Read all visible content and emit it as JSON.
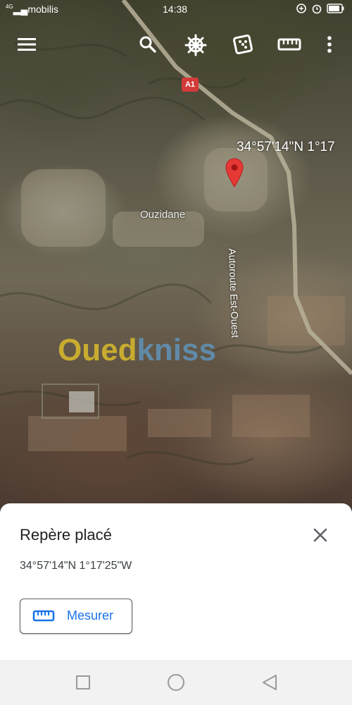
{
  "status_bar": {
    "carrier": "mobilis",
    "network": "4G",
    "time": "14:38",
    "icons": [
      "alarm-clock-icon",
      "battery-icon"
    ]
  },
  "toolbar": {
    "icons": [
      "menu-icon",
      "search-icon",
      "ships-wheel-icon",
      "dice-icon",
      "ruler-icon",
      "more-vert-icon"
    ]
  },
  "map": {
    "road_shield": "A1",
    "coordinate_label": "34°57'14\"N 1°17",
    "place_name": "Ouzidane",
    "road_name": "Autoroute Est-Ouest",
    "watermark_part1": "Oued",
    "watermark_part2": "kniss",
    "pin_color": "#e53935"
  },
  "sheet": {
    "title": "Repère placé",
    "coordinates": "34°57'14\"N 1°17'25\"W",
    "measure_label": "Mesurer",
    "accent": "#1a73e8"
  },
  "nav": {
    "buttons": [
      "recent-apps",
      "home",
      "back"
    ]
  }
}
